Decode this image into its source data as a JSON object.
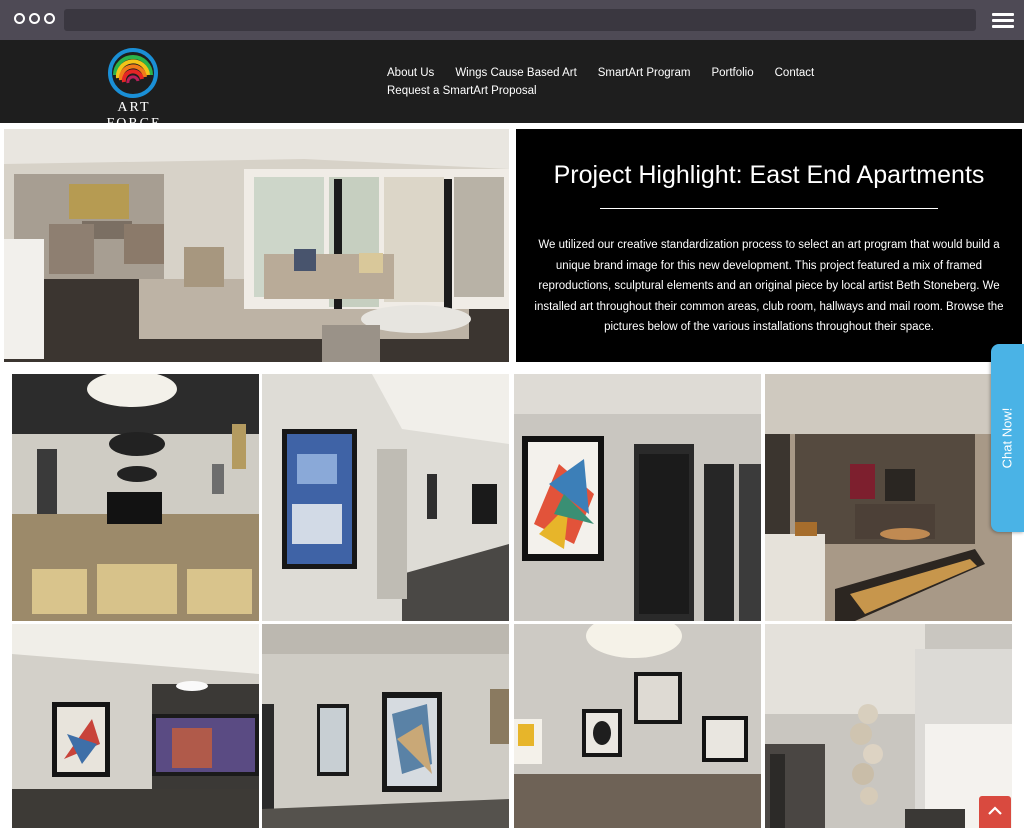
{
  "browser": {
    "window_controls_icon": "three-dots-icon",
    "menu_icon": "hamburger-icon"
  },
  "header": {
    "logo_text": "ART FORCE",
    "nav": [
      {
        "label": "About Us"
      },
      {
        "label": "Wings Cause Based Art"
      },
      {
        "label": "SmartArt Program"
      },
      {
        "label": "Portfolio"
      },
      {
        "label": "Contact"
      },
      {
        "label": "Request a SmartArt Proposal"
      }
    ]
  },
  "hero": {
    "title": "Project Highlight: East End Apartments",
    "body": "We utilized our creative standardization process to select an art program that would build a unique brand image for this new  development. This project featured a mix of framed reproductions, sculptural elements and an original piece by local artist Beth Stoneberg. We installed art throughout their common areas, club room, hallways and mail room. Browse the pictures below of the various installations throughout their space."
  },
  "chat": {
    "label": "Chat Now!"
  },
  "back_to_top_icon": "chevron-up-icon",
  "colors": {
    "header_bg": "#1e1e1e",
    "chrome_bg": "#4e4a55",
    "chat_tab": "#4ab3e6",
    "back_to_top": "#d94a3f"
  }
}
